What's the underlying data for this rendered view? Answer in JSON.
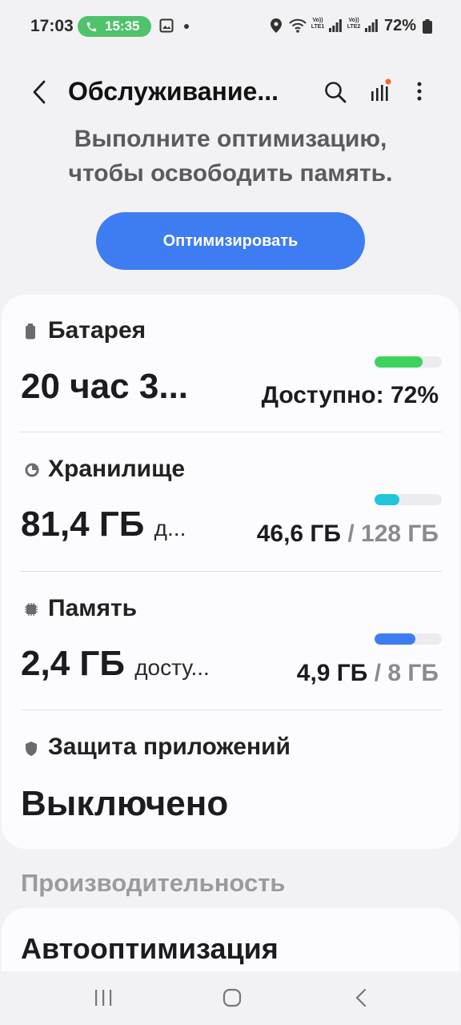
{
  "status_bar": {
    "time": "17:03",
    "call_timer": "15:35",
    "battery_percent": "72%",
    "sim1_label": "Vo)) LTE1",
    "sim2_label": "Vo)) LTE2"
  },
  "header": {
    "title": "Обслуживание...",
    "back_icon": "chevron-left-icon",
    "search_icon": "search-icon",
    "stats_icon": "bar-chart-icon",
    "more_icon": "more-vertical-icon"
  },
  "hint": {
    "line1": "Выполните оптимизацию,",
    "line2": "чтобы освободить память."
  },
  "optimize_button": {
    "label": "Оптимизировать",
    "color": "#3e7cf2"
  },
  "items": {
    "battery": {
      "label": "Батарея",
      "value": "20 час 3...",
      "status": "Доступно: 72%",
      "level": 0.72,
      "color": "#3fd25e"
    },
    "storage": {
      "label": "Хранилище",
      "value": "81,4 ГБ",
      "value_suffix": "д...",
      "used": "46,6 ГБ",
      "separator": "/",
      "total": "128 ГБ",
      "level": 0.364,
      "color": "#22c4dc"
    },
    "memory": {
      "label": "Память",
      "value": "2,4 ГБ",
      "value_suffix": "досту...",
      "used": "4,9 ГБ",
      "separator": "/",
      "total": "8 ГБ",
      "level": 0.61,
      "color": "#3e7cf2"
    },
    "app_protection": {
      "label": "Защита приложений",
      "value": "Выключено"
    }
  },
  "performance": {
    "section_title": "Производительность",
    "auto_optimization_label": "Автооптимизация"
  }
}
